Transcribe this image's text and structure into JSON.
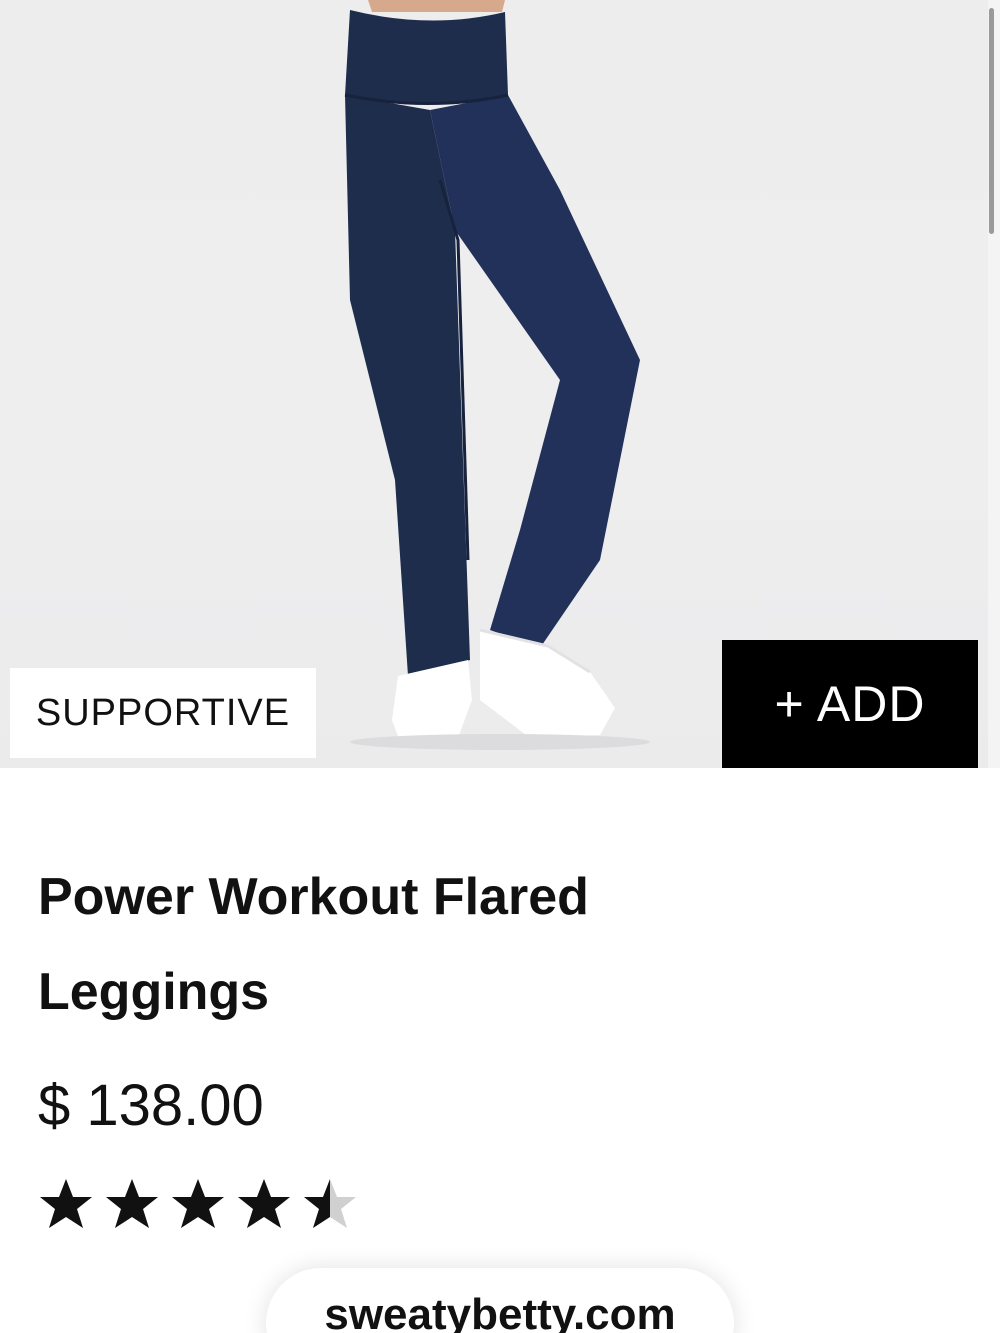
{
  "product": {
    "badge": "SUPPORTIVE",
    "add_label": "+ ADD",
    "title": "Power Workout Flared Leggings",
    "price": "$ 138.00",
    "rating": 4.5,
    "rating_max": 5
  },
  "browser": {
    "url": "sweatybetty.com"
  },
  "colors": {
    "leggings": "#1f2d4d",
    "background": "#ededee",
    "button": "#000000",
    "star_filled": "#111111",
    "star_empty": "#d0d0d0"
  }
}
